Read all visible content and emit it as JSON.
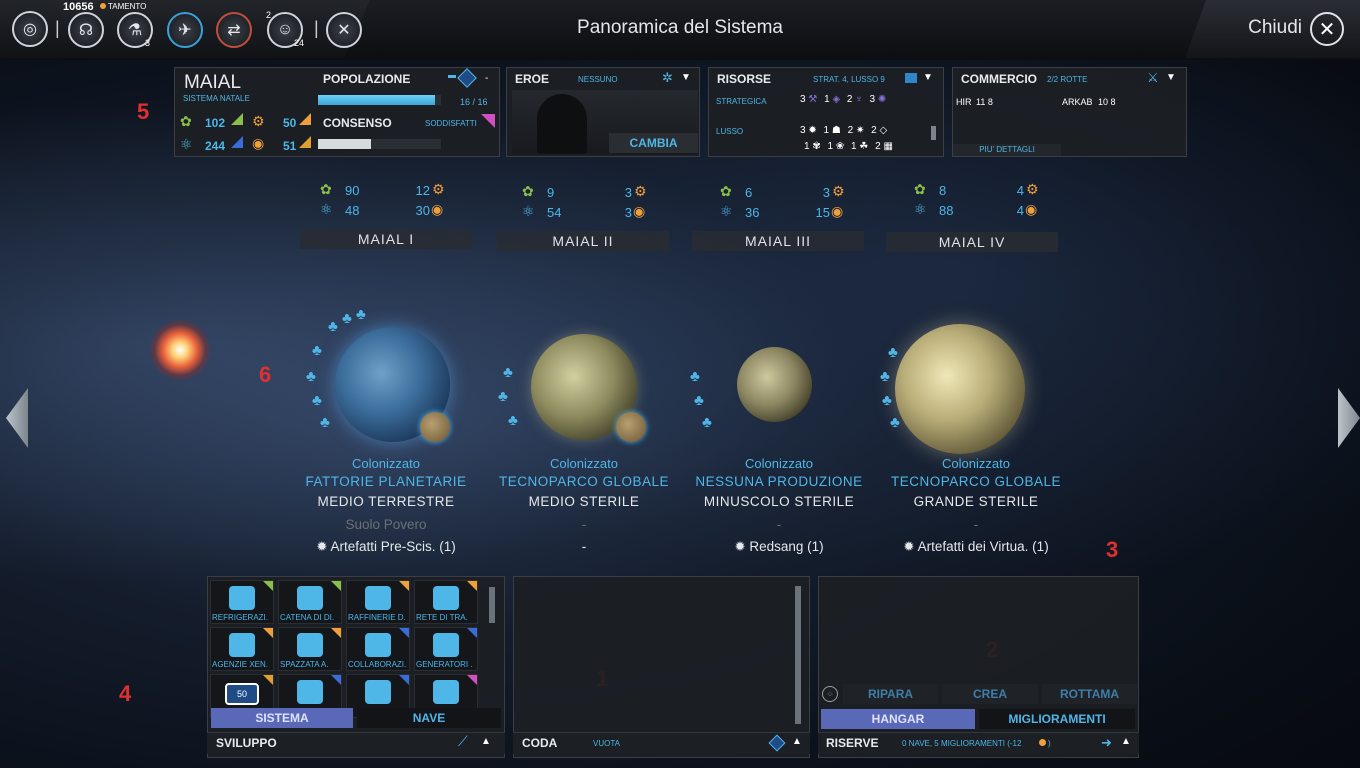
{
  "topbar": {
    "dust": "10656",
    "dust_suffix": "TAMENTO",
    "badge_research": "3",
    "badge_pop1": "2",
    "badge_pop2": "24",
    "title": "Panoramica del Sistema",
    "close_label": "Chiudi"
  },
  "system": {
    "name": "MAIAL",
    "subtitle": "SISTEMA NATALE",
    "food": "102",
    "industry": "50",
    "science": "244",
    "dust": "51"
  },
  "population": {
    "label": "POPOLAZIONE",
    "dash": "-",
    "count": "16 / 16",
    "fill": 0.95,
    "consensus_label": "CONSENSO",
    "consensus_state": "SODDISFATTI",
    "consensus_fill": 0.43
  },
  "hero": {
    "label": "EROE",
    "value": "NESSUNO",
    "change_button": "CAMBIA"
  },
  "resources": {
    "label": "RISORSE",
    "summary": "STRAT. 4, LUSSO 9",
    "strategic_label": "STRATEGICA",
    "strategic": [
      "3",
      "1",
      "2",
      "3"
    ],
    "luxury_label": "LUSSO",
    "luxury_row1": [
      "3",
      "1",
      "2",
      "2"
    ],
    "luxury_row2": [
      "1",
      "1",
      "1",
      "2"
    ]
  },
  "trade": {
    "label": "COMMERCIO",
    "routes": "2/2 ROTTE",
    "partner1": "HIR",
    "partner1_vals": "11 8",
    "partner2": "ARKAB",
    "partner2_vals": "10 8",
    "more": "PIU' DETTAGLI"
  },
  "planets": [
    {
      "name": "MAIAL I",
      "food": "90",
      "industry": "12",
      "science": "48",
      "dust": "30",
      "status": "Colonizzato",
      "production": "FATTORIE PLANETARIE",
      "type": "MEDIO TERRESTRE",
      "extra": "Suolo Povero",
      "resource": "Artefatti Pre-Scis. (1)"
    },
    {
      "name": "MAIAL II",
      "food": "9",
      "industry": "3",
      "science": "54",
      "dust": "3",
      "status": "Colonizzato",
      "production": "TECNOPARCO GLOBALE",
      "type": "MEDIO STERILE",
      "extra": "-",
      "resource": "-"
    },
    {
      "name": "MAIAL III",
      "food": "6",
      "industry": "3",
      "science": "36",
      "dust": "15",
      "status": "Colonizzato",
      "production": "NESSUNA PRODUZIONE",
      "type": "MINUSCOLO STERILE",
      "extra": "-",
      "resource": "Redsang (1)"
    },
    {
      "name": "MAIAL IV",
      "food": "8",
      "industry": "4",
      "science": "88",
      "dust": "4",
      "status": "Colonizzato",
      "production": "TECNOPARCO GLOBALE",
      "type": "GRANDE STERILE",
      "extra": "-",
      "resource": "Artefatti dei Virtua. (1)"
    }
  ],
  "markers": [
    "1",
    "2",
    "3",
    "4",
    "5",
    "6"
  ],
  "development": {
    "tiles": [
      "REFRIGERAZI.",
      "CATENA DI DI.",
      "RAFFINERIE D.",
      "RETE DI TRA.",
      "AGENZIE XEN.",
      "SPAZZATA A.",
      "COLLABORAZI.",
      "GENERATORI .",
      "50",
      "",
      "",
      ""
    ],
    "tab_system": "SISTEMA",
    "tab_ship": "NAVE",
    "footer": "SVILUPPO"
  },
  "queue": {
    "footer": "CODA",
    "status": "VUOTA"
  },
  "hangar": {
    "repair": "RIPARA",
    "create": "CREA",
    "scrap": "ROTTAMA",
    "tab_hangar": "HANGAR",
    "tab_upgrades": "MIGLIORAMENTI",
    "footer": "RISERVE",
    "footer_detail": "0 NAVE, 5 MIGLIORAMENTI (-12"
  },
  "colors": {
    "accent": "#4fb6e8",
    "orange": "#f0a03a",
    "green": "#8ac04a",
    "tab_active": "#5a68b8",
    "marker": "#e03030"
  },
  "icons": [
    "empire-icon",
    "diplomacy-icon",
    "research-icon",
    "heroes-icon",
    "trade-icon",
    "population-icon",
    "settings-icon",
    "close-icon"
  ]
}
